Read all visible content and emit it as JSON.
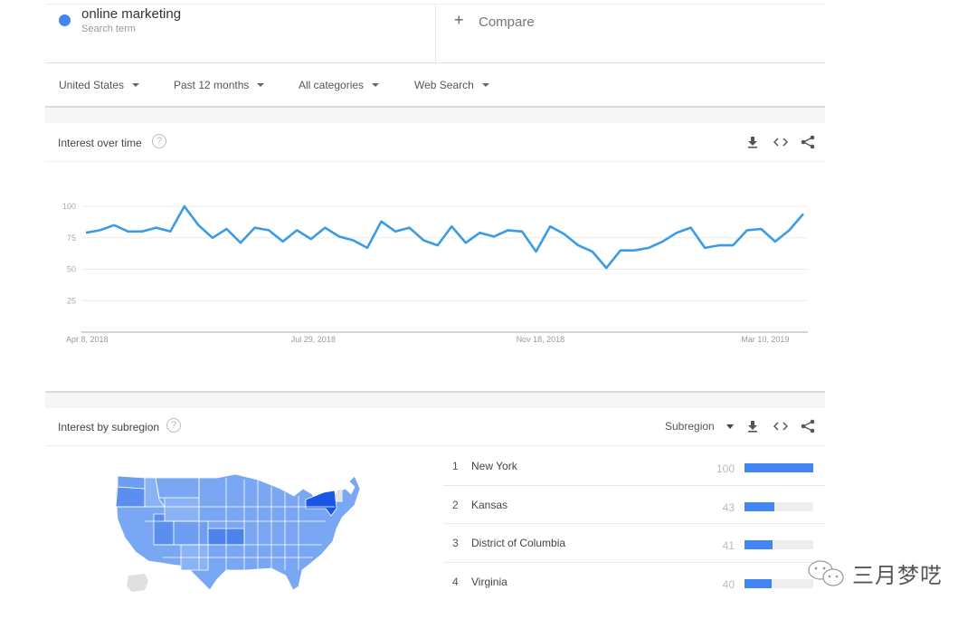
{
  "search_term": {
    "name": "online marketing",
    "subtitle": "Search term",
    "color": "#4285f4"
  },
  "compare": {
    "icon": "plus-icon",
    "label": "Compare"
  },
  "filters": [
    {
      "label": "United States"
    },
    {
      "label": "Past 12 months"
    },
    {
      "label": "All categories"
    },
    {
      "label": "Web Search"
    }
  ],
  "interest_over_time": {
    "title": "Interest over time",
    "help_icon": "?",
    "tools": [
      "download-icon",
      "embed-icon",
      "share-icon"
    ]
  },
  "chart_data": {
    "type": "line",
    "title": "Interest over time",
    "xlabel": "",
    "ylabel": "",
    "ylim": [
      0,
      100
    ],
    "yticks": [
      25,
      50,
      75,
      100
    ],
    "xticks": [
      "Apr 8, 2018",
      "Jul 29, 2018",
      "Nov 18, 2018",
      "Mar 10, 2019"
    ],
    "xtick_indices": [
      0,
      16,
      32,
      48
    ],
    "grid": true,
    "series": [
      {
        "name": "online marketing",
        "color": "#3b9be6",
        "values": [
          79,
          81,
          85,
          80,
          80,
          83,
          80,
          100,
          85,
          75,
          82,
          71,
          83,
          81,
          72,
          81,
          74,
          83,
          76,
          73,
          67,
          88,
          80,
          83,
          73,
          69,
          84,
          71,
          79,
          76,
          81,
          80,
          64,
          84,
          78,
          69,
          64,
          51,
          65,
          65,
          67,
          72,
          79,
          83,
          67,
          69,
          69,
          81,
          82,
          72,
          81,
          94
        ]
      }
    ]
  },
  "interest_by_subregion": {
    "title": "Interest by subregion",
    "help_icon": "?",
    "select_label": "Subregion",
    "tools": [
      "download-icon",
      "embed-icon",
      "share-icon"
    ],
    "rankings": [
      {
        "rank": "1",
        "name": "New York",
        "value": "100",
        "fraction": 1.0
      },
      {
        "rank": "2",
        "name": "Kansas",
        "value": "43",
        "fraction": 0.43
      },
      {
        "rank": "3",
        "name": "District of Columbia",
        "value": "41",
        "fraction": 0.41
      },
      {
        "rank": "4",
        "name": "Virginia",
        "value": "40",
        "fraction": 0.4
      }
    ],
    "map_colors": {
      "highest": "#1a56e6",
      "high": "#5a8ff0",
      "mid": "#6e9ef2",
      "low": "#8ab3f5",
      "none": "#e0e0e0"
    }
  },
  "watermark": {
    "text": "三月梦呓"
  }
}
